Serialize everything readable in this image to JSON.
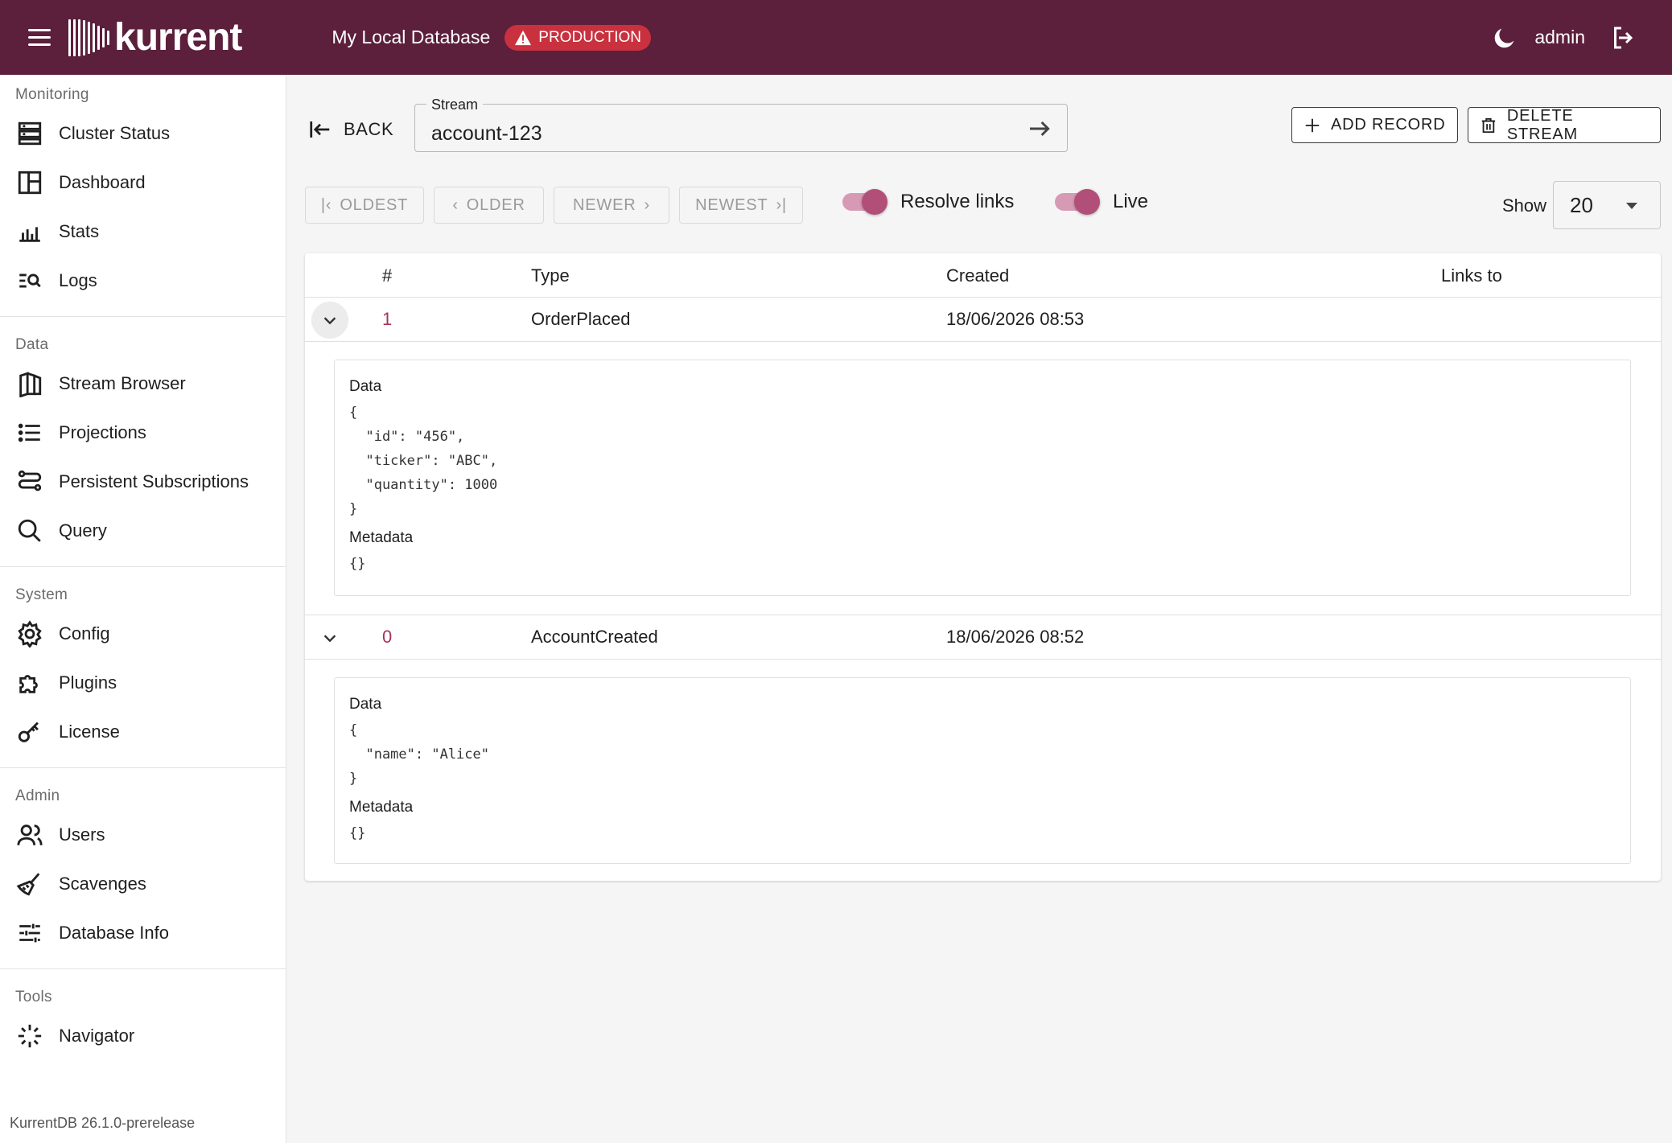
{
  "header": {
    "logo_text": "kurrent",
    "database_name": "My Local Database",
    "env_badge": "PRODUCTION",
    "user": "admin"
  },
  "sidebar": {
    "sections": [
      {
        "title": "Monitoring",
        "items": [
          {
            "label": "Cluster Status",
            "icon": "server-icon"
          },
          {
            "label": "Dashboard",
            "icon": "dashboard-icon"
          },
          {
            "label": "Stats",
            "icon": "bar-chart-icon"
          },
          {
            "label": "Logs",
            "icon": "log-search-icon"
          }
        ]
      },
      {
        "title": "Data",
        "items": [
          {
            "label": "Stream Browser",
            "icon": "stream-icon"
          },
          {
            "label": "Projections",
            "icon": "list-icon"
          },
          {
            "label": "Persistent Subscriptions",
            "icon": "subscription-icon"
          },
          {
            "label": "Query",
            "icon": "search-icon"
          }
        ]
      },
      {
        "title": "System",
        "items": [
          {
            "label": "Config",
            "icon": "gear-icon"
          },
          {
            "label": "Plugins",
            "icon": "puzzle-icon"
          },
          {
            "label": "License",
            "icon": "key-icon"
          }
        ]
      },
      {
        "title": "Admin",
        "items": [
          {
            "label": "Users",
            "icon": "users-icon"
          },
          {
            "label": "Scavenges",
            "icon": "broom-icon"
          },
          {
            "label": "Database Info",
            "icon": "sliders-icon"
          }
        ]
      },
      {
        "title": "Tools",
        "items": [
          {
            "label": "Navigator",
            "icon": "navigator-icon"
          }
        ]
      }
    ],
    "version": "KurrentDB 26.1.0-prerelease"
  },
  "toolbar": {
    "back_label": "BACK",
    "stream_label": "Stream",
    "stream_value": "account-123",
    "add_record_label": "ADD RECORD",
    "delete_stream_label": "DELETE STREAM"
  },
  "pager": {
    "oldest": "OLDEST",
    "older": "OLDER",
    "newer": "NEWER",
    "newest": "NEWEST"
  },
  "toggles": {
    "resolve_links": {
      "label": "Resolve links",
      "on": true
    },
    "live": {
      "label": "Live",
      "on": true
    }
  },
  "show": {
    "label": "Show",
    "value": "20"
  },
  "table": {
    "headers": {
      "num": "#",
      "type": "Type",
      "created": "Created",
      "links": "Links to"
    },
    "rows": [
      {
        "num": "1",
        "type": "OrderPlaced",
        "created": "18/06/2026 08:53",
        "links": "",
        "data_label": "Data",
        "data_json": "{\n  \"id\": \"456\",\n  \"ticker\": \"ABC\",\n  \"quantity\": 1000\n}",
        "metadata_label": "Metadata",
        "metadata_json": "{}"
      },
      {
        "num": "0",
        "type": "AccountCreated",
        "created": "18/06/2026 08:52",
        "links": "",
        "data_label": "Data",
        "data_json": "{\n  \"name\": \"Alice\"\n}",
        "metadata_label": "Metadata",
        "metadata_json": "{}"
      }
    ]
  },
  "colors": {
    "header_bg": "#5c1f3c",
    "badge": "#c9313f",
    "accent": "#a8325f",
    "toggle": "#b24f78"
  }
}
